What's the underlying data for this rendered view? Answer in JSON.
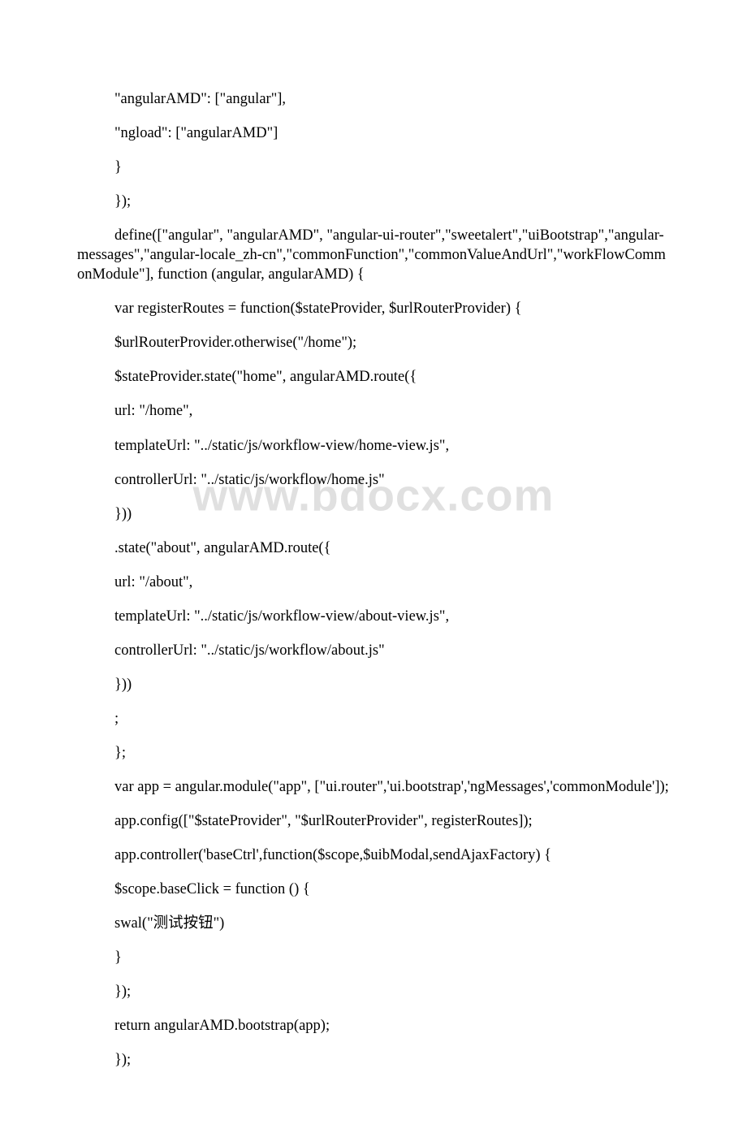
{
  "watermark": "www.bdocx.com",
  "lines": [
    "\"angularAMD\": [\"angular\"],",
    "\"ngload\": [\"angularAMD\"]",
    "}",
    "});",
    "define([\"angular\", \"angularAMD\", \"angular-ui-router\",\"sweetalert\",\"uiBootstrap\",\"angular-messages\",\"angular-locale_zh-cn\",\"commonFunction\",\"commonValueAndUrl\",\"workFlowCommonModule\"], function (angular, angularAMD) {",
    "var registerRoutes = function($stateProvider, $urlRouterProvider) {",
    "$urlRouterProvider.otherwise(\"/home\");",
    "$stateProvider.state(\"home\", angularAMD.route({",
    "url: \"/home\",",
    "templateUrl: \"../static/js/workflow-view/home-view.js\",",
    "controllerUrl: \"../static/js/workflow/home.js\"",
    "}))",
    ".state(\"about\", angularAMD.route({",
    "url: \"/about\",",
    "templateUrl: \"../static/js/workflow-view/about-view.js\",",
    "controllerUrl: \"../static/js/workflow/about.js\"",
    "}))",
    ";",
    "};",
    "var app = angular.module(\"app\", [\"ui.router\",'ui.bootstrap','ngMessages','commonModule']);",
    "app.config([\"$stateProvider\", \"$urlRouterProvider\", registerRoutes]);",
    "app.controller('baseCtrl',function($scope,$uibModal,sendAjaxFactory) {",
    "$scope.baseClick = function () {",
    "swal(\"测试按钮\")",
    "}",
    "});",
    "return angularAMD.bootstrap(app);",
    "});"
  ]
}
